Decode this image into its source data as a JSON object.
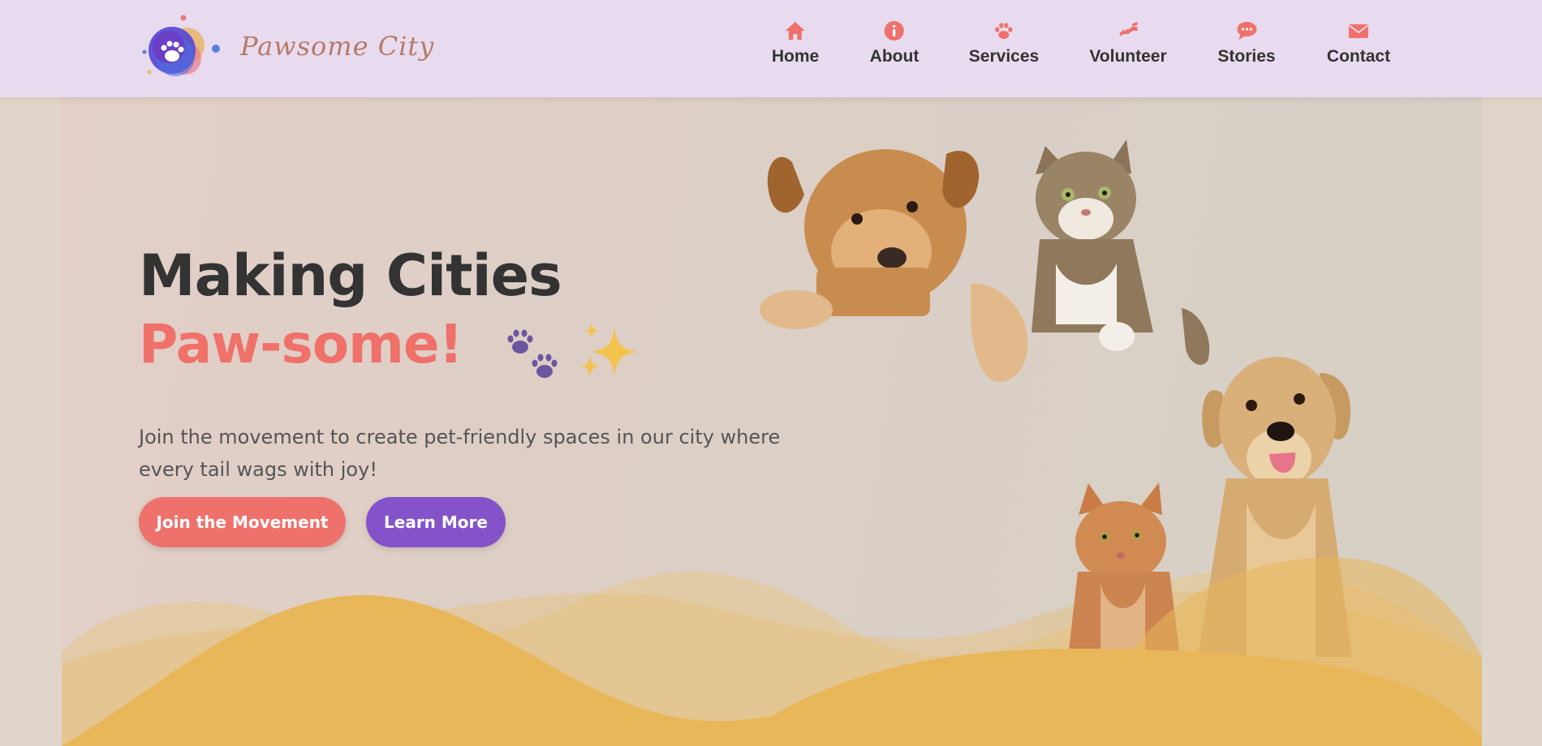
{
  "brand": {
    "name": "Pawsome City",
    "logo_icon": "paw-bubbles-logo"
  },
  "nav": {
    "items": [
      {
        "label": "Home",
        "icon": "home-icon"
      },
      {
        "label": "About",
        "icon": "info-icon"
      },
      {
        "label": "Services",
        "icon": "paw-icon"
      },
      {
        "label": "Volunteer",
        "icon": "hands-helping-icon"
      },
      {
        "label": "Stories",
        "icon": "chat-bubble-icon"
      },
      {
        "label": "Contact",
        "icon": "envelope-icon"
      }
    ]
  },
  "hero": {
    "title_line1": "Making Cities",
    "title_line2": "Paw-some!",
    "subtitle": "Join the movement to create pet-friendly spaces in our city where every tail wags with joy!",
    "primary_button": "Join the Movement",
    "secondary_button": "Learn More",
    "images": [
      "dog-peeking",
      "cat-peeking",
      "cat-sitting",
      "dog-sitting"
    ]
  },
  "colors": {
    "header_bg": "#e8dbef",
    "accent_coral": "#ef716b",
    "accent_purple": "#8453c9",
    "wave_gold": "#e8b75a",
    "text_dark": "#333333",
    "brand_text": "#b57a66"
  }
}
